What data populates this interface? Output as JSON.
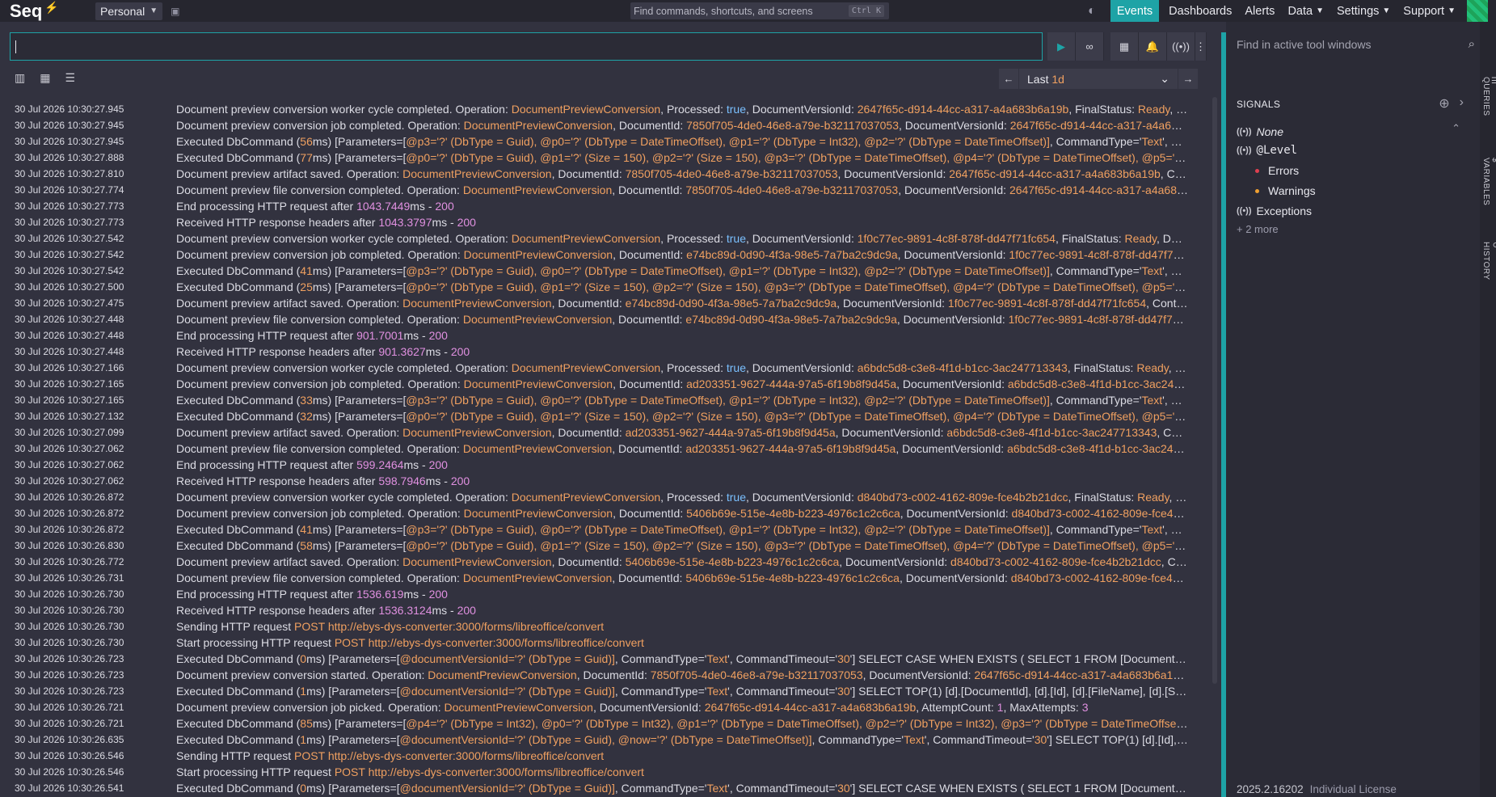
{
  "app": {
    "logo_text": "Seq",
    "workspace": "Personal"
  },
  "command_search": {
    "placeholder": "Find commands, shortcuts, and screens",
    "shortcut": "Ctrl K"
  },
  "nav": {
    "events": "Events",
    "dashboards": "Dashboards",
    "alerts": "Alerts",
    "data": "Data",
    "settings": "Settings",
    "support": "Support"
  },
  "range": {
    "prefix": "Last ",
    "value": "1d"
  },
  "side": {
    "find_placeholder": "Find in active tool windows",
    "signals_title": "SIGNALS",
    "none": "None",
    "level": "@Level",
    "errors": "Errors",
    "warnings": "Warnings",
    "exceptions": "Exceptions",
    "more": "+ 2 more",
    "version": "2025.2.16202",
    "license": "Individual License",
    "tab_queries": "QUERIES",
    "tab_variables": "VARIABLES",
    "tab_history": "HISTORY"
  },
  "colors": {
    "accent": "#1ea3a6",
    "property": "#f0a060",
    "boolean": "#7ac0ff",
    "number": "#e090e0",
    "error_dot": "#e04050",
    "warning_dot": "#f0a030"
  },
  "events": [
    {
      "ts": "30 Jul 2026  10:30:27.945",
      "msg": "Document preview conversion worker cycle completed. Operation: [[p:DocumentPreviewConversion]], Processed: [[b:true]], DocumentVersionId: [[p:2647f65c-d914-44cc-a317-a4a683b6a19b]], FinalStatus: [[p:Ready]], Dur..."
    },
    {
      "ts": "30 Jul 2026  10:30:27.945",
      "msg": "Document preview conversion job completed. Operation: [[p:DocumentPreviewConversion]], DocumentId: [[p:7850f705-4de0-46e8-a79e-b32117037053]], DocumentVersionId: [[p:2647f65c-d914-44cc-a317-a4a683...]]"
    },
    {
      "ts": "30 Jul 2026  10:30:27.945",
      "msg": "Executed DbCommand ([[p:56]]ms) [Parameters=[[[p:@p3='?' (DbType = Guid), @p0='?' (DbType = DateTimeOffset), @p1='?' (DbType = Int32), @p2='?' (DbType = DateTimeOffset)]]], CommandType='[[p:Text]]', Comm..."
    },
    {
      "ts": "30 Jul 2026  10:30:27.888",
      "msg": "Executed DbCommand ([[p:77]]ms) [Parameters=[[[p:@p0='?' (DbType = Guid), @p1='?' (Size = 150), @p2='?' (Size = 150), @p3='?' (DbType = DateTimeOffset), @p4='?' (DbType = DateTimeOffset), @p5='?' (DbTy...]]"
    },
    {
      "ts": "30 Jul 2026  10:30:27.810",
      "msg": "Document preview artifact saved. Operation: [[p:DocumentPreviewConversion]], DocumentId: [[p:7850f705-4de0-46e8-a79e-b32117037053]], DocumentVersionId: [[p:2647f65c-d914-44cc-a317-a4a683b6a19b]], Con..."
    },
    {
      "ts": "30 Jul 2026  10:30:27.774",
      "msg": "Document preview file conversion completed. Operation: [[p:DocumentPreviewConversion]], DocumentId: [[p:7850f705-4de0-46e8-a79e-b32117037053]], DocumentVersionId: [[p:2647f65c-d914-44cc-a317-a4a683...]]"
    },
    {
      "ts": "30 Jul 2026  10:30:27.773",
      "msg": "End processing HTTP request after [[n:1043.7449]]ms - [[n:200]]"
    },
    {
      "ts": "30 Jul 2026  10:30:27.773",
      "msg": "Received HTTP response headers after [[n:1043.3797]]ms - [[n:200]]"
    },
    {
      "ts": "30 Jul 2026  10:30:27.542",
      "msg": "Document preview conversion worker cycle completed. Operation: [[p:DocumentPreviewConversion]], Processed: [[b:true]], DocumentVersionId: [[p:1f0c77ec-9891-4c8f-878f-dd47f71fc654]], FinalStatus: [[p:Ready]], Durat..."
    },
    {
      "ts": "30 Jul 2026  10:30:27.542",
      "msg": "Document preview conversion job completed. Operation: [[p:DocumentPreviewConversion]], DocumentId: [[p:e74bc89d-0d90-4f3a-98e5-7a7ba2c9dc9a]], DocumentVersionId: [[p:1f0c77ec-9891-4c8f-878f-dd47f71f...]]"
    },
    {
      "ts": "30 Jul 2026  10:30:27.542",
      "msg": "Executed DbCommand ([[p:41]]ms) [Parameters=[[[p:@p3='?' (DbType = Guid), @p0='?' (DbType = DateTimeOffset), @p1='?' (DbType = Int32), @p2='?' (DbType = DateTimeOffset)]]], CommandType='[[p:Text]]', Comm..."
    },
    {
      "ts": "30 Jul 2026  10:30:27.500",
      "msg": "Executed DbCommand ([[p:25]]ms) [Parameters=[[[p:@p0='?' (DbType = Guid), @p1='?' (Size = 150), @p2='?' (Size = 150), @p3='?' (DbType = DateTimeOffset), @p4='?' (DbType = DateTimeOffset), @p5='?' (DbTy...]]"
    },
    {
      "ts": "30 Jul 2026  10:30:27.475",
      "msg": "Document preview artifact saved. Operation: [[p:DocumentPreviewConversion]], DocumentId: [[p:e74bc89d-0d90-4f3a-98e5-7a7ba2c9dc9a]], DocumentVersionId: [[p:1f0c77ec-9891-4c8f-878f-dd47f71fc654]], Conte..."
    },
    {
      "ts": "30 Jul 2026  10:30:27.448",
      "msg": "Document preview file conversion completed. Operation: [[p:DocumentPreviewConversion]], DocumentId: [[p:e74bc89d-0d90-4f3a-98e5-7a7ba2c9dc9a]], DocumentVersionId: [[p:1f0c77ec-9891-4c8f-878f-dd47f71f...]]"
    },
    {
      "ts": "30 Jul 2026  10:30:27.448",
      "msg": "End processing HTTP request after [[n:901.7001]]ms - [[n:200]]"
    },
    {
      "ts": "30 Jul 2026  10:30:27.448",
      "msg": "Received HTTP response headers after [[n:901.3627]]ms - [[n:200]]"
    },
    {
      "ts": "30 Jul 2026  10:30:27.166",
      "msg": "Document preview conversion worker cycle completed. Operation: [[p:DocumentPreviewConversion]], Processed: [[b:true]], DocumentVersionId: [[p:a6bdc5d8-c3e8-4f1d-b1cc-3ac247713343]], FinalStatus: [[p:Ready]], Dur..."
    },
    {
      "ts": "30 Jul 2026  10:30:27.165",
      "msg": "Document preview conversion job completed. Operation: [[p:DocumentPreviewConversion]], DocumentId: [[p:ad203351-9627-444a-97a5-6f19b8f9d45a]], DocumentVersionId: [[p:a6bdc5d8-c3e8-4f1d-b1cc-3ac2477...]]"
    },
    {
      "ts": "30 Jul 2026  10:30:27.165",
      "msg": "Executed DbCommand ([[p:33]]ms) [Parameters=[[[p:@p3='?' (DbType = Guid), @p0='?' (DbType = DateTimeOffset), @p1='?' (DbType = Int32), @p2='?' (DbType = DateTimeOffset)]]], CommandType='[[p:Text]]', Comm..."
    },
    {
      "ts": "30 Jul 2026  10:30:27.132",
      "msg": "Executed DbCommand ([[p:32]]ms) [Parameters=[[[p:@p0='?' (DbType = Guid), @p1='?' (Size = 150), @p2='?' (Size = 150), @p3='?' (DbType = DateTimeOffset), @p4='?' (DbType = DateTimeOffset), @p5='?' (DbTy...]]"
    },
    {
      "ts": "30 Jul 2026  10:30:27.099",
      "msg": "Document preview artifact saved. Operation: [[p:DocumentPreviewConversion]], DocumentId: [[p:ad203351-9627-444a-97a5-6f19b8f9d45a]], DocumentVersionId: [[p:a6bdc5d8-c3e8-4f1d-b1cc-3ac247713343]], Cont..."
    },
    {
      "ts": "30 Jul 2026  10:30:27.062",
      "msg": "Document preview file conversion completed. Operation: [[p:DocumentPreviewConversion]], DocumentId: [[p:ad203351-9627-444a-97a5-6f19b8f9d45a]], DocumentVersionId: [[p:a6bdc5d8-c3e8-4f1d-b1cc-3ac2477...]]"
    },
    {
      "ts": "30 Jul 2026  10:30:27.062",
      "msg": "End processing HTTP request after [[n:599.2464]]ms - [[n:200]]"
    },
    {
      "ts": "30 Jul 2026  10:30:27.062",
      "msg": "Received HTTP response headers after [[n:598.7946]]ms - [[n:200]]"
    },
    {
      "ts": "30 Jul 2026  10:30:26.872",
      "msg": "Document preview conversion worker cycle completed. Operation: [[p:DocumentPreviewConversion]], Processed: [[b:true]], DocumentVersionId: [[p:d840bd73-c002-4162-809e-fce4b2b21dcc]], FinalStatus: [[p:Ready]], Dur..."
    },
    {
      "ts": "30 Jul 2026  10:30:26.872",
      "msg": "Document preview conversion job completed. Operation: [[p:DocumentPreviewConversion]], DocumentId: [[p:5406b69e-515e-4e8b-b223-4976c1c2c6ca]], DocumentVersionId: [[p:d840bd73-c002-4162-809e-fce4b2...]]"
    },
    {
      "ts": "30 Jul 2026  10:30:26.872",
      "msg": "Executed DbCommand ([[p:41]]ms) [Parameters=[[[p:@p3='?' (DbType = Guid), @p0='?' (DbType = DateTimeOffset), @p1='?' (DbType = Int32), @p2='?' (DbType = DateTimeOffset)]]], CommandType='[[p:Text]]', Comm..."
    },
    {
      "ts": "30 Jul 2026  10:30:26.830",
      "msg": "Executed DbCommand ([[p:58]]ms) [Parameters=[[[p:@p0='?' (DbType = Guid), @p1='?' (Size = 150), @p2='?' (Size = 150), @p3='?' (DbType = DateTimeOffset), @p4='?' (DbType = DateTimeOffset), @p5='?' (DbTy...]]"
    },
    {
      "ts": "30 Jul 2026  10:30:26.772",
      "msg": "Document preview artifact saved. Operation: [[p:DocumentPreviewConversion]], DocumentId: [[p:5406b69e-515e-4e8b-b223-4976c1c2c6ca]], DocumentVersionId: [[p:d840bd73-c002-4162-809e-fce4b2b21dcc]], Con..."
    },
    {
      "ts": "30 Jul 2026  10:30:26.731",
      "msg": "Document preview file conversion completed. Operation: [[p:DocumentPreviewConversion]], DocumentId: [[p:5406b69e-515e-4e8b-b223-4976c1c2c6ca]], DocumentVersionId: [[p:d840bd73-c002-4162-809e-fce4b2...]]"
    },
    {
      "ts": "30 Jul 2026  10:30:26.730",
      "msg": "End processing HTTP request after [[n:1536.619]]ms - [[n:200]]"
    },
    {
      "ts": "30 Jul 2026  10:30:26.730",
      "msg": "Received HTTP response headers after [[n:1536.3124]]ms - [[n:200]]"
    },
    {
      "ts": "30 Jul 2026  10:30:26.730",
      "msg": "Sending HTTP request [[p:POST]] [[p:http://ebys-dys-converter:3000/forms/libreoffice/convert]]"
    },
    {
      "ts": "30 Jul 2026  10:30:26.730",
      "msg": "Start processing HTTP request [[p:POST]] [[p:http://ebys-dys-converter:3000/forms/libreoffice/convert]]"
    },
    {
      "ts": "30 Jul 2026  10:30:26.723",
      "msg": "Executed DbCommand ([[p:0]]ms) [Parameters=[[[p:@documentVersionId='?' (DbType = Guid)]]], CommandType='[[p:Text]]', CommandTimeout='[[p:30]]'] SELECT CASE WHEN EXISTS ( SELECT 1 FROM [DocumentPrevie..."
    },
    {
      "ts": "30 Jul 2026  10:30:26.723",
      "msg": "Document preview conversion started. Operation: [[p:DocumentPreviewConversion]], DocumentId: [[p:7850f705-4de0-46e8-a79e-b32117037053]], DocumentVersionId: [[p:2647f65c-d914-44cc-a317-a4a683b6a19b]],..."
    },
    {
      "ts": "30 Jul 2026  10:30:26.723",
      "msg": "Executed DbCommand ([[p:1]]ms) [Parameters=[[[p:@documentVersionId='?' (DbType = Guid)]]], CommandType='[[p:Text]]', CommandTimeout='[[p:30]]'] SELECT TOP(1) [d].[DocumentId], [d].[Id], [d].[FileName], [d].[Storag..."
    },
    {
      "ts": "30 Jul 2026  10:30:26.721",
      "msg": "Document preview conversion job picked. Operation: [[p:DocumentPreviewConversion]], DocumentVersionId: [[p:2647f65c-d914-44cc-a317-a4a683b6a19b]], AttemptCount: [[n:1]], MaxAttempts: [[n:3]]"
    },
    {
      "ts": "30 Jul 2026  10:30:26.721",
      "msg": "Executed DbCommand ([[p:85]]ms) [Parameters=[[[p:@p4='?' (DbType = Int32), @p0='?' (DbType = Int32), @p1='?' (DbType = DateTimeOffset), @p2='?' (DbType = Int32), @p3='?' (DbType = DateTimeOffset)]]], Co..."
    },
    {
      "ts": "30 Jul 2026  10:30:26.635",
      "msg": "Executed DbCommand ([[p:1]]ms) [Parameters=[[[p:@documentVersionId='?' (DbType = Guid), @now='?' (DbType = DateTimeOffset)]]], CommandType='[[p:Text]]', CommandTimeout='[[p:30]]'] SELECT TOP(1) [d].[Id], [d].[..."
    },
    {
      "ts": "30 Jul 2026  10:30:26.546",
      "msg": "Sending HTTP request [[p:POST]] [[p:http://ebys-dys-converter:3000/forms/libreoffice/convert]]"
    },
    {
      "ts": "30 Jul 2026  10:30:26.546",
      "msg": "Start processing HTTP request [[p:POST]] [[p:http://ebys-dys-converter:3000/forms/libreoffice/convert]]"
    },
    {
      "ts": "30 Jul 2026  10:30:26.541",
      "msg": "Executed DbCommand ([[p:0]]ms) [Parameters=[[[p:@documentVersionId='?' (DbType = Guid)]]], CommandType='[[p:Text]]', CommandTimeout='[[p:30]]'] SELECT CASE WHEN EXISTS ( SELECT 1 FROM [DocumentPrevie..."
    }
  ]
}
